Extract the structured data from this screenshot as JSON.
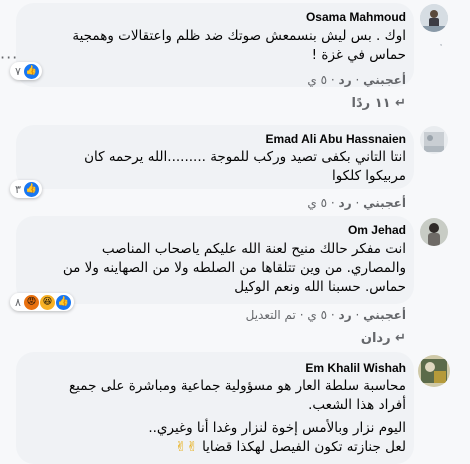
{
  "comments": [
    {
      "author": "Osama Mahmoud",
      "lines": [
        "اوك . بس ليش بنسمعش صوتك ضد ظلم واعتقالات وهمجية",
        "حماس في غزة !"
      ],
      "reaction_count": "٧",
      "like_label": "أعجبني",
      "reply_label": "رد",
      "time": "٥ ي"
    },
    {
      "author": "Emad Ali Abu Hassnaien",
      "lines": [
        "انتا التاني بكفى تصيد وركب للموجة .........الله يرحمه كان",
        "مربيكوا كلكوا"
      ],
      "reaction_count": "٣",
      "like_label": "أعجبني",
      "reply_label": "رد",
      "time": "٥ ي"
    },
    {
      "author": "Om Jehad",
      "lines": [
        "انت مفكر حالك منيح لعنة الله عليكم ياصحاب المناصب",
        "والمصاري. من وين تتلقاها من الصلطه ولا من الصهاينه ولا من",
        "حماس. حسبنا الله ونعم الوكيل"
      ],
      "reaction_count": "٨",
      "like_label": "أعجبني",
      "reply_label": "رد",
      "time": "٥ ي",
      "edited_label": "تم التعديل"
    },
    {
      "author": "Em Khalil Wishah",
      "lines": [
        "محاسبة سلطة العار هو مسؤولية جماعية ومباشرة على جميع",
        "أفراد هذا الشعب.",
        "اليوم نزار وبالأمس إخوة لنزار وغدا أنا وغيري..",
        "لعل جنازته تكون الفيصل لهكذا قضايا"
      ]
    }
  ],
  "replies": [
    {
      "label": "١١ ردًا"
    },
    {
      "label": "ردان"
    }
  ],
  "separator": "·"
}
